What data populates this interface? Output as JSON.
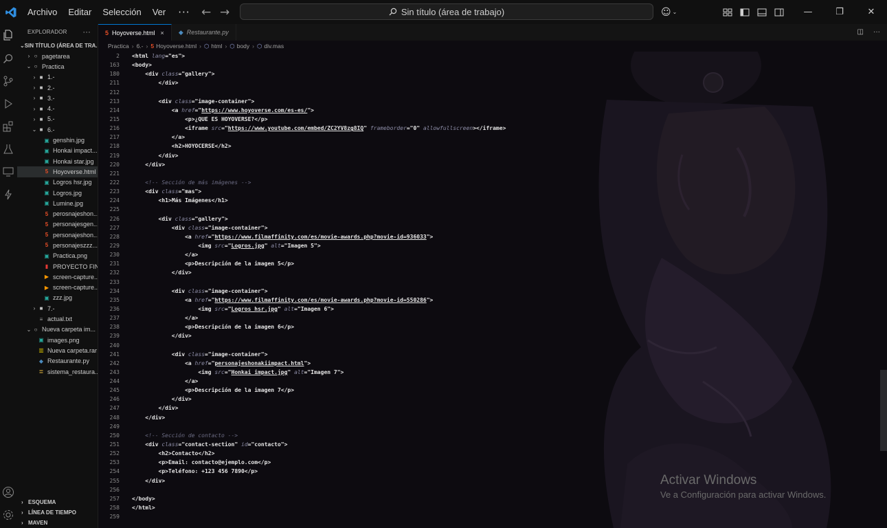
{
  "titlebar": {
    "menu": [
      "Archivo",
      "Editar",
      "Selección",
      "Ver"
    ],
    "more": "···",
    "search_text": "Sin título (área de trabajo)"
  },
  "sidebar": {
    "title": "EXPLORADOR",
    "more": "···",
    "workspace": "SIN TÍTULO (ÁREA DE TRA...",
    "items": [
      {
        "label": "pagetarea",
        "indent": 1,
        "chev": "›",
        "icon": "circle"
      },
      {
        "label": "Practica",
        "indent": 1,
        "chev": "⌄",
        "icon": "circle"
      },
      {
        "label": "1.-",
        "indent": 2,
        "chev": "›",
        "icon": "folder"
      },
      {
        "label": "2.-",
        "indent": 2,
        "chev": "›",
        "icon": "folder"
      },
      {
        "label": "3.-",
        "indent": 2,
        "chev": "›",
        "icon": "folder"
      },
      {
        "label": "4.-",
        "indent": 2,
        "chev": "›",
        "icon": "folder"
      },
      {
        "label": "5.-",
        "indent": 2,
        "chev": "›",
        "icon": "folder"
      },
      {
        "label": "6.-",
        "indent": 2,
        "chev": "⌄",
        "icon": "folder"
      },
      {
        "label": "genshin.jpg",
        "indent": 3,
        "chev": "",
        "icon": "image"
      },
      {
        "label": "Honkai impact...",
        "indent": 3,
        "chev": "",
        "icon": "image"
      },
      {
        "label": "Honkai star.jpg",
        "indent": 3,
        "chev": "",
        "icon": "image"
      },
      {
        "label": "Hoyoverse.html",
        "indent": 3,
        "chev": "",
        "icon": "html",
        "selected": true
      },
      {
        "label": "Logros hsr.jpg",
        "indent": 3,
        "chev": "",
        "icon": "image"
      },
      {
        "label": "Logros.jpg",
        "indent": 3,
        "chev": "",
        "icon": "image"
      },
      {
        "label": "Lumine.jpg",
        "indent": 3,
        "chev": "",
        "icon": "image"
      },
      {
        "label": "perosnajeshon...",
        "indent": 3,
        "chev": "",
        "icon": "html"
      },
      {
        "label": "personajesgen...",
        "indent": 3,
        "chev": "",
        "icon": "html"
      },
      {
        "label": "personajeshon...",
        "indent": 3,
        "chev": "",
        "icon": "html"
      },
      {
        "label": "personajeszzz...",
        "indent": 3,
        "chev": "",
        "icon": "html"
      },
      {
        "label": "Practica.png",
        "indent": 3,
        "chev": "",
        "icon": "image"
      },
      {
        "label": "PROYECTO FIN...",
        "indent": 3,
        "chev": "",
        "icon": "pdf"
      },
      {
        "label": "screen-capture...",
        "indent": 3,
        "chev": "",
        "icon": "video"
      },
      {
        "label": "screen-capture...",
        "indent": 3,
        "chev": "",
        "icon": "video"
      },
      {
        "label": "zzz.jpg",
        "indent": 3,
        "chev": "",
        "icon": "image"
      },
      {
        "label": "7.-",
        "indent": 2,
        "chev": "›",
        "icon": "folder"
      },
      {
        "label": "actual.txt",
        "indent": 2,
        "chev": "",
        "icon": "text"
      },
      {
        "label": "Nueva carpeta im...",
        "indent": 1,
        "chev": "⌄",
        "icon": "circle"
      },
      {
        "label": "images.png",
        "indent": 2,
        "chev": "",
        "icon": "image"
      },
      {
        "label": "Nueva carpeta.rar",
        "indent": 2,
        "chev": "",
        "icon": "archive"
      },
      {
        "label": "Restaurante.py",
        "indent": 2,
        "chev": "",
        "icon": "python"
      },
      {
        "label": "sistema_restaura...",
        "indent": 2,
        "chev": "",
        "icon": "database"
      }
    ],
    "bottom_sections": [
      "ESQUEMA",
      "LÍNEA DE TIEMPO",
      "MAVEN"
    ]
  },
  "tabs": [
    {
      "label": "Hoyoverse.html",
      "icon": "html",
      "active": true,
      "close": "×"
    },
    {
      "label": "Restaurante.py",
      "icon": "python",
      "active": false
    }
  ],
  "breadcrumb": [
    "Practica",
    "6.-",
    "Hoyoverse.html",
    "html",
    "body",
    "div.mas"
  ],
  "editor": {
    "line_numbers": [
      "2",
      "163",
      "180",
      "211",
      "212",
      "213",
      "214",
      "215",
      "216",
      "217",
      "218",
      "219",
      "220",
      "221",
      "222",
      "223",
      "224",
      "225",
      "226",
      "227",
      "228",
      "229",
      "230",
      "231",
      "232",
      "233",
      "234",
      "235",
      "236",
      "237",
      "238",
      "239",
      "240",
      "241",
      "242",
      "243",
      "244",
      "245",
      "246",
      "247",
      "248",
      "249",
      "250",
      "251",
      "252",
      "253",
      "254",
      "255",
      "256",
      "257",
      "258",
      "259"
    ],
    "lines": [
      "<html lang=\"es\">",
      "<body>",
      "    <div class=\"gallery\">",
      "        </div>",
      "",
      "        <div class=\"image-container\">",
      "            <a href=\"https://www.hoyoverse.com/es-es/\">",
      "                <p>¿QUE ES HOYOVERSE?</p>",
      "                <iframe src=\"https://www.youtube.com/embed/ZC2YV8zg8IQ\" frameborder=\"0\" allowfullscreen></iframe>",
      "            </a>",
      "            <h2>HOYOCERSE</h2>",
      "        </div>",
      "    </div>",
      "",
      "    <!-- Sección de más imágenes -->",
      "    <div class=\"mas\">",
      "        <h1>Más Imágenes</h1>",
      "",
      "        <div class=\"gallery\">",
      "            <div class=\"image-container\">",
      "                <a href=\"https://www.filmaffinity.com/es/movie-awards.php?movie-id=936033\">",
      "                    <img src=\"Logros.jpg\" alt=\"Imagen 5\">",
      "                </a>",
      "                <p>Descripción de la imagen 5</p>",
      "            </div>",
      "",
      "            <div class=\"image-container\">",
      "                <a href=\"https://www.filmaffinity.com/es/movie-awards.php?movie-id=550286\">",
      "                    <img src=\"Logros hsr.jpg\" alt=\"Imagen 6\">",
      "                </a>",
      "                <p>Descripción de la imagen 6</p>",
      "            </div>",
      "",
      "            <div class=\"image-container\">",
      "                <a href=\"personajeshonakiimpact.html\">",
      "                    <img src=\"Honkai impact.jpg\" alt=\"Imagen 7\">",
      "                </a>",
      "                <p>Descripción de la imagen 7</p>",
      "            </div>",
      "        </div>",
      "    </div>",
      "",
      "    <!-- Sección de contacto -->",
      "    <div class=\"contact-section\" id=\"contacto\">",
      "        <h2>Contacto</h2>",
      "        <p>Email: contacto@ejemplo.com</p>",
      "        <p>Teléfono: +123 456 7890</p>",
      "    </div>",
      "",
      "</body>",
      "</html>",
      ""
    ]
  },
  "watermark": {
    "title": "Activar Windows",
    "subtitle": "Ve a Configuración para activar Windows."
  },
  "colors": {
    "background": "#0d0b10",
    "chrome": "#101010",
    "accent": "#0078d4",
    "html_icon": "#e44d26",
    "image_icon": "#26a69a",
    "python_icon": "#3572A5"
  }
}
